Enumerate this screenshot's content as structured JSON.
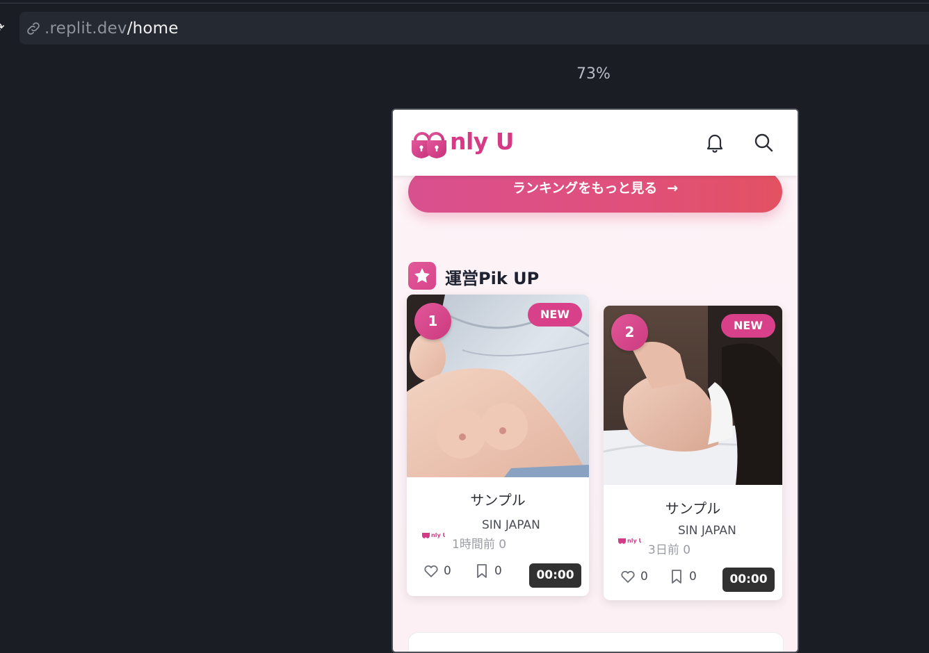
{
  "browser": {
    "url_domain": ".replit.dev",
    "url_path": "/home",
    "zoom": "73%"
  },
  "app": {
    "logo_text": "nly U",
    "brand_color": "#d43a86",
    "ranking_button": {
      "label": "ランキングをもっと見る",
      "arrow": "→"
    },
    "section": {
      "title": "運営Pik UP",
      "icon": "star-icon"
    },
    "cards": [
      {
        "rank": "1",
        "badge": "NEW",
        "duration": "00:00",
        "title": "サンプル",
        "author": "SIN JAPAN",
        "meta": "1時間前 0",
        "likes": "0",
        "bookmarks": "0"
      },
      {
        "rank": "2",
        "badge": "NEW",
        "duration": "00:00",
        "title": "サンプル",
        "author": "SIN JAPAN",
        "meta": "3日前 0",
        "likes": "0",
        "bookmarks": "0"
      }
    ]
  }
}
